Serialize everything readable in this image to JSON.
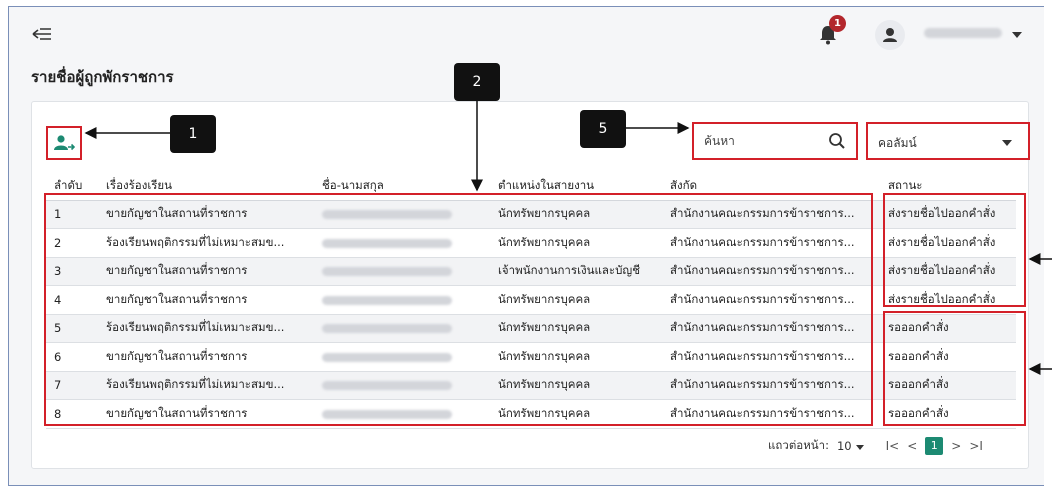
{
  "header": {
    "back_icon": "collapse-menu-icon",
    "notification_count": "1",
    "page_title": "รายชื่อผู้ถูกพักราชการ"
  },
  "toolbar": {
    "search_placeholder": "ค้นหา",
    "column_select_label": "คอลัมน์"
  },
  "table": {
    "columns": [
      "ลำดับ",
      "เรื่องร้องเรียน",
      "ชื่อ-นามสกุล",
      "ตำแหน่งในสายงาน",
      "สังกัด",
      "สถานะ"
    ],
    "rows": [
      {
        "no": "1",
        "complaint": "ขายกัญชาในสถานที่ราชการ",
        "position": "นักทรัพยากรบุคคล",
        "agency": "สำนักงานคณะกรรมการข้าราชการ...",
        "status": "ส่งรายชื่อไปออกคำสั่ง"
      },
      {
        "no": "2",
        "complaint": "ร้องเรียนพฤติกรรมที่ไม่เหมาะสมข...",
        "position": "นักทรัพยากรบุคคล",
        "agency": "สำนักงานคณะกรรมการข้าราชการ...",
        "status": "ส่งรายชื่อไปออกคำสั่ง"
      },
      {
        "no": "3",
        "complaint": "ขายกัญชาในสถานที่ราชการ",
        "position": "เจ้าพนักงานการเงินและบัญชี",
        "agency": "สำนักงานคณะกรรมการข้าราชการ...",
        "status": "ส่งรายชื่อไปออกคำสั่ง"
      },
      {
        "no": "4",
        "complaint": "ขายกัญชาในสถานที่ราชการ",
        "position": "นักทรัพยากรบุคคล",
        "agency": "สำนักงานคณะกรรมการข้าราชการ...",
        "status": "ส่งรายชื่อไปออกคำสั่ง"
      },
      {
        "no": "5",
        "complaint": "ร้องเรียนพฤติกรรมที่ไม่เหมาะสมข...",
        "position": "นักทรัพยากรบุคคล",
        "agency": "สำนักงานคณะกรรมการข้าราชการ...",
        "status": "รอออกคำสั่ง"
      },
      {
        "no": "6",
        "complaint": "ขายกัญชาในสถานที่ราชการ",
        "position": "นักทรัพยากรบุคคล",
        "agency": "สำนักงานคณะกรรมการข้าราชการ...",
        "status": "รอออกคำสั่ง"
      },
      {
        "no": "7",
        "complaint": "ร้องเรียนพฤติกรรมที่ไม่เหมาะสมข...",
        "position": "นักทรัพยากรบุคคล",
        "agency": "สำนักงานคณะกรรมการข้าราชการ...",
        "status": "รอออกคำสั่ง"
      },
      {
        "no": "8",
        "complaint": "ขายกัญชาในสถานที่ราชการ",
        "position": "นักทรัพยากรบุคคล",
        "agency": "สำนักงานคณะกรรมการข้าราชการ...",
        "status": "รอออกคำสั่ง"
      }
    ]
  },
  "pagination": {
    "rows_per_page_label": "แถวต่อหน้า:",
    "rows_per_page": "10",
    "first": "I<",
    "prev": "<",
    "current_page": "1",
    "next": ">",
    "last": ">I"
  },
  "callouts": {
    "c1": "1",
    "c2": "2",
    "c5": "5"
  },
  "colors": {
    "highlight": "#d32029",
    "accent": "#1c8a72",
    "badge": "#b3272d"
  }
}
